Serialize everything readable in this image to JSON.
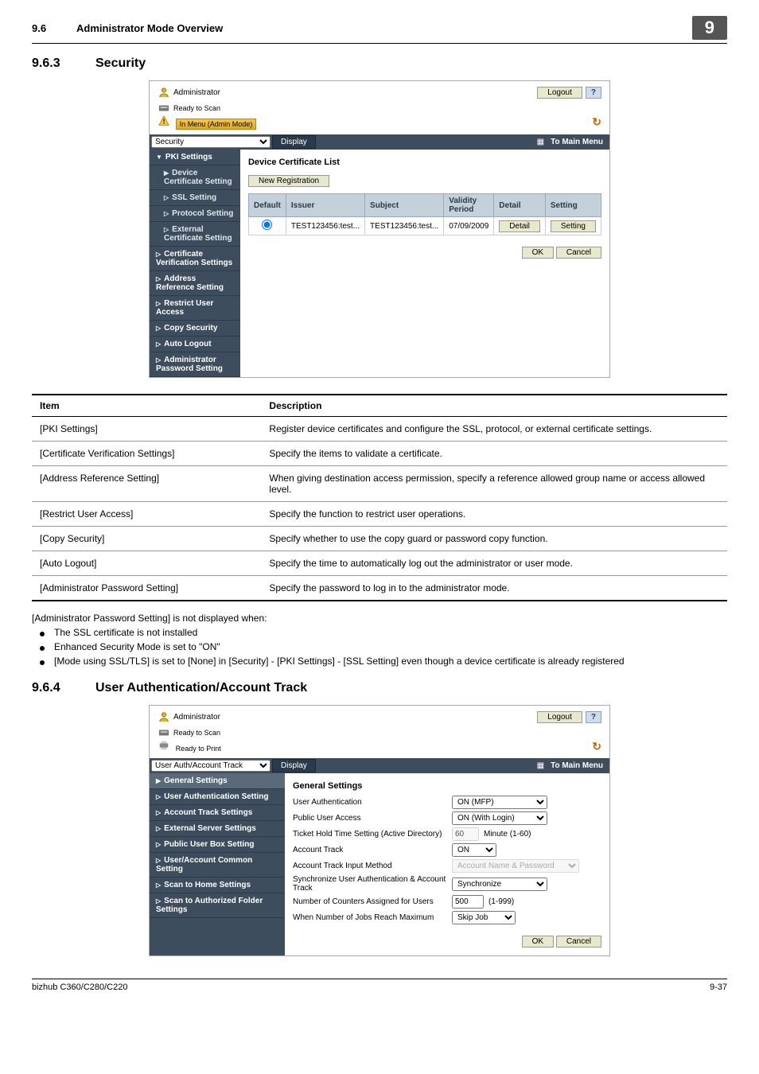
{
  "header": {
    "section_number": "9.6",
    "section_title": "Administrator Mode Overview",
    "chapter": "9"
  },
  "sec_963": {
    "number": "9.6.3",
    "title": "Security"
  },
  "sec_964": {
    "number": "9.6.4",
    "title": "User Authentication/Account Track"
  },
  "app_sec": {
    "title": "Administrator",
    "logout": "Logout",
    "help": "?",
    "ready": "Ready to Scan",
    "mode": "In Menu (Admin Mode)",
    "dropdown": "Security",
    "display": "Display",
    "to_main": "To Main Menu",
    "nav": [
      "PKI Settings",
      "Device Certificate Setting",
      "SSL Setting",
      "Protocol Setting",
      "External Certificate Setting",
      "Certificate Verification Settings",
      "Address Reference Setting",
      "Restrict User Access",
      "Copy Security",
      "Auto Logout",
      "Administrator Password Setting"
    ],
    "content_title": "Device Certificate List",
    "new_reg": "New Registration",
    "cols": {
      "default": "Default",
      "issuer": "Issuer",
      "subject": "Subject",
      "validity": "Validity Period",
      "detail": "Detail",
      "setting": "Setting"
    },
    "row": {
      "issuer": "TEST123456:test...",
      "subject": "TEST123456:test...",
      "validity": "07/09/2009",
      "detail": "Detail",
      "setting": "Setting"
    },
    "ok": "OK",
    "cancel": "Cancel"
  },
  "desc_table": {
    "head_item": "Item",
    "head_desc": "Description",
    "rows": [
      {
        "item": "[PKI Settings]",
        "desc": "Register device certificates and configure the SSL, protocol, or external certificate settings."
      },
      {
        "item": "[Certificate Verification Settings]",
        "desc": "Specify the items to validate a certificate."
      },
      {
        "item": "[Address Reference Setting]",
        "desc": "When giving destination access permission, specify a reference allowed group name or access allowed level."
      },
      {
        "item": "[Restrict User Access]",
        "desc": "Specify the function to restrict user operations."
      },
      {
        "item": "[Copy Security]",
        "desc": "Specify whether to use the copy guard or password copy function."
      },
      {
        "item": "[Auto Logout]",
        "desc": "Specify the time to automatically log out the administrator or user mode."
      },
      {
        "item": "[Administrator Password Setting]",
        "desc": "Specify the password to log in to the administrator mode."
      }
    ]
  },
  "notes": {
    "intro": "[Administrator Password Setting] is not displayed when:",
    "bullets": [
      "The SSL certificate is not installed",
      "Enhanced Security Mode is set to \"ON\"",
      "[Mode using SSL/TLS] is set to [None] in [Security] - [PKI Settings] - [SSL Setting] even though a device certificate is already registered"
    ]
  },
  "app_auth": {
    "title": "Administrator",
    "logout": "Logout",
    "help": "?",
    "ready1": "Ready to Scan",
    "ready2": "Ready to Print",
    "dropdown": "User Auth/Account Track",
    "display": "Display",
    "to_main": "To Main Menu",
    "nav": [
      "General Settings",
      "User Authentication Setting",
      "Account Track Settings",
      "External Server Settings",
      "Public User Box Setting",
      "User/Account Common Setting",
      "Scan to Home Settings",
      "Scan to Authorized Folder Settings"
    ],
    "content_title": "General Settings",
    "rows": {
      "user_auth": {
        "label": "User Authentication",
        "value": "ON (MFP)"
      },
      "public_user": {
        "label": "Public User Access",
        "value": "ON (With Login)"
      },
      "ticket_hold": {
        "label": "Ticket Hold Time Setting (Active Directory)",
        "value": "60",
        "suffix": "Minute (1-60)"
      },
      "acct_track": {
        "label": "Account Track",
        "value": "ON"
      },
      "acct_input": {
        "label": "Account Track Input Method",
        "value": "Account Name & Password"
      },
      "sync": {
        "label": "Synchronize User Authentication & Account Track",
        "value": "Synchronize"
      },
      "num_counters": {
        "label": "Number of Counters Assigned for Users",
        "value": "500",
        "suffix": "(1-999)"
      },
      "jobs_max": {
        "label": "When Number of Jobs Reach Maximum",
        "value": "Skip Job"
      }
    },
    "ok": "OK",
    "cancel": "Cancel"
  },
  "footer": {
    "left": "bizhub C360/C280/C220",
    "right": "9-37"
  }
}
